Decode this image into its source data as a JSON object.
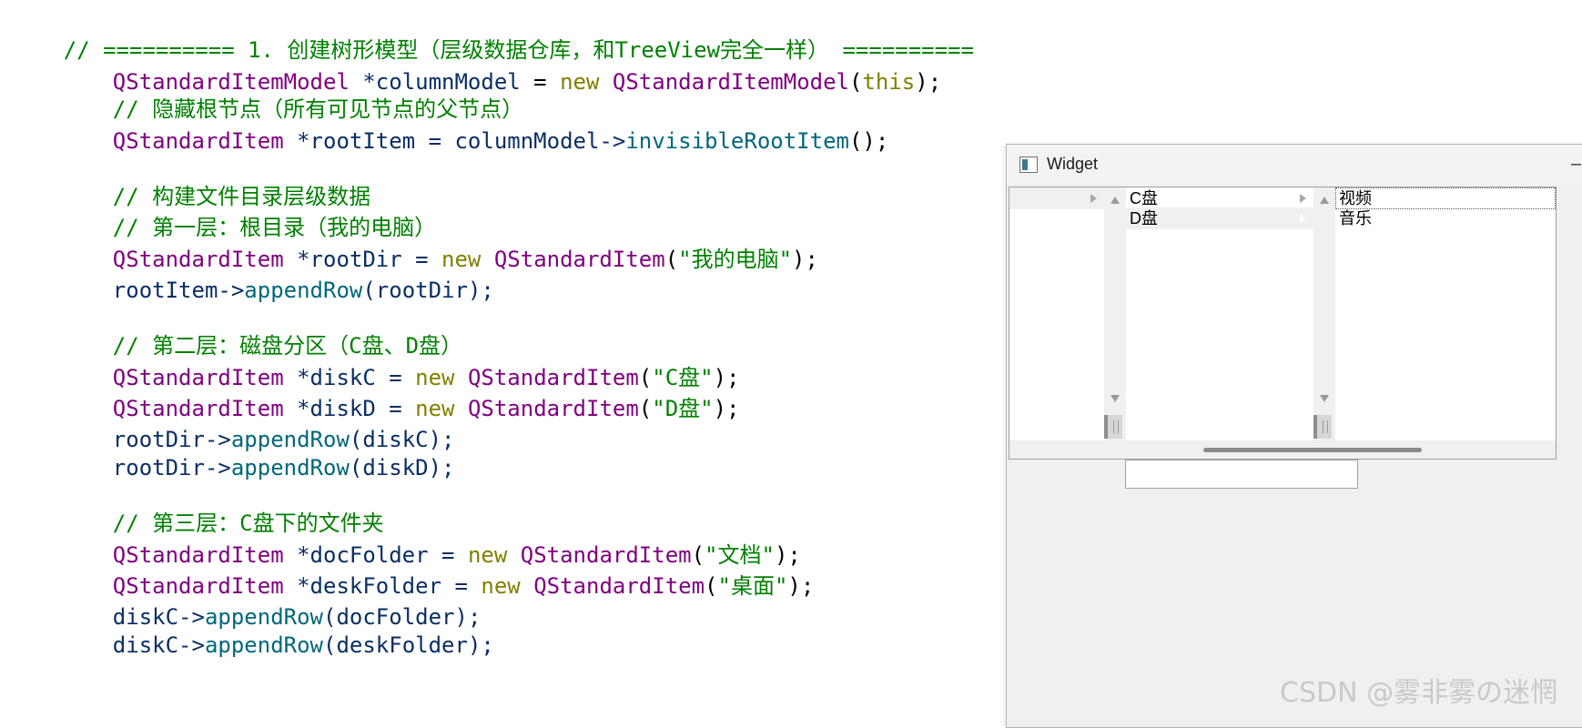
{
  "code": {
    "line1": "// ========== 1. 创建树形模型（层级数据仓库，和TreeView完全一样） ==========",
    "line2": {
      "type": "QStandardItemModel",
      "var": " *columnModel",
      "op": " = ",
      "kw": "new",
      "sp": " ",
      "cls": "QStandardItemModel",
      "open": "(",
      "arg": "this",
      "close": ");"
    },
    "line3": "// 隐藏根节点（所有可见节点的父节点）",
    "line4": {
      "type": "QStandardItem",
      "var": " *rootItem = columnModel->",
      "fn": "invisibleRootItem",
      "end": "();"
    },
    "line5": "// 构建文件目录层级数据",
    "line6": "// 第一层：根目录（我的电脑）",
    "line7": {
      "type": "QStandardItem",
      "var": " *rootDir = ",
      "kw": "new",
      "cls": " QStandardItem",
      "open": "(",
      "str": "\"我的电脑\"",
      "end": ");"
    },
    "line8": {
      "var": "rootItem->",
      "fn": "appendRow",
      "end": "(rootDir);"
    },
    "line9": "// 第二层：磁盘分区（C盘、D盘）",
    "line10": {
      "type": "QStandardItem",
      "var": " *diskC = ",
      "kw": "new",
      "cls": " QStandardItem",
      "open": "(",
      "str": "\"C盘\"",
      "end": ");"
    },
    "line11": {
      "type": "QStandardItem",
      "var": " *diskD = ",
      "kw": "new",
      "cls": " QStandardItem",
      "open": "(",
      "str": "\"D盘\"",
      "end": ");"
    },
    "line12": {
      "var": "rootDir->",
      "fn": "appendRow",
      "end": "(diskC);"
    },
    "line13": {
      "var": "rootDir->",
      "fn": "appendRow",
      "end": "(diskD);"
    },
    "line14": "// 第三层：C盘下的文件夹",
    "line15": {
      "type": "QStandardItem",
      "var": " *docFolder = ",
      "kw": "new",
      "cls": " QStandardItem",
      "open": "(",
      "str": "\"文档\"",
      "end": ");"
    },
    "line16": {
      "type": "QStandardItem",
      "var": " *deskFolder = ",
      "kw": "new",
      "cls": " QStandardItem",
      "open": "(",
      "str": "\"桌面\"",
      "end": ");"
    },
    "line17": {
      "var": "diskC->",
      "fn": "appendRow",
      "end": "(docFolder);"
    },
    "line18": {
      "var": "diskC->",
      "fn": "appendRow",
      "end": "(deskFolder);"
    }
  },
  "window": {
    "title": "Widget",
    "minimize_glyph": "–",
    "column2_items": [
      "C盘",
      "D盘"
    ],
    "column3_items": [
      "视频",
      "音乐"
    ]
  },
  "watermark": "CSDN @雾非雾の迷惘"
}
